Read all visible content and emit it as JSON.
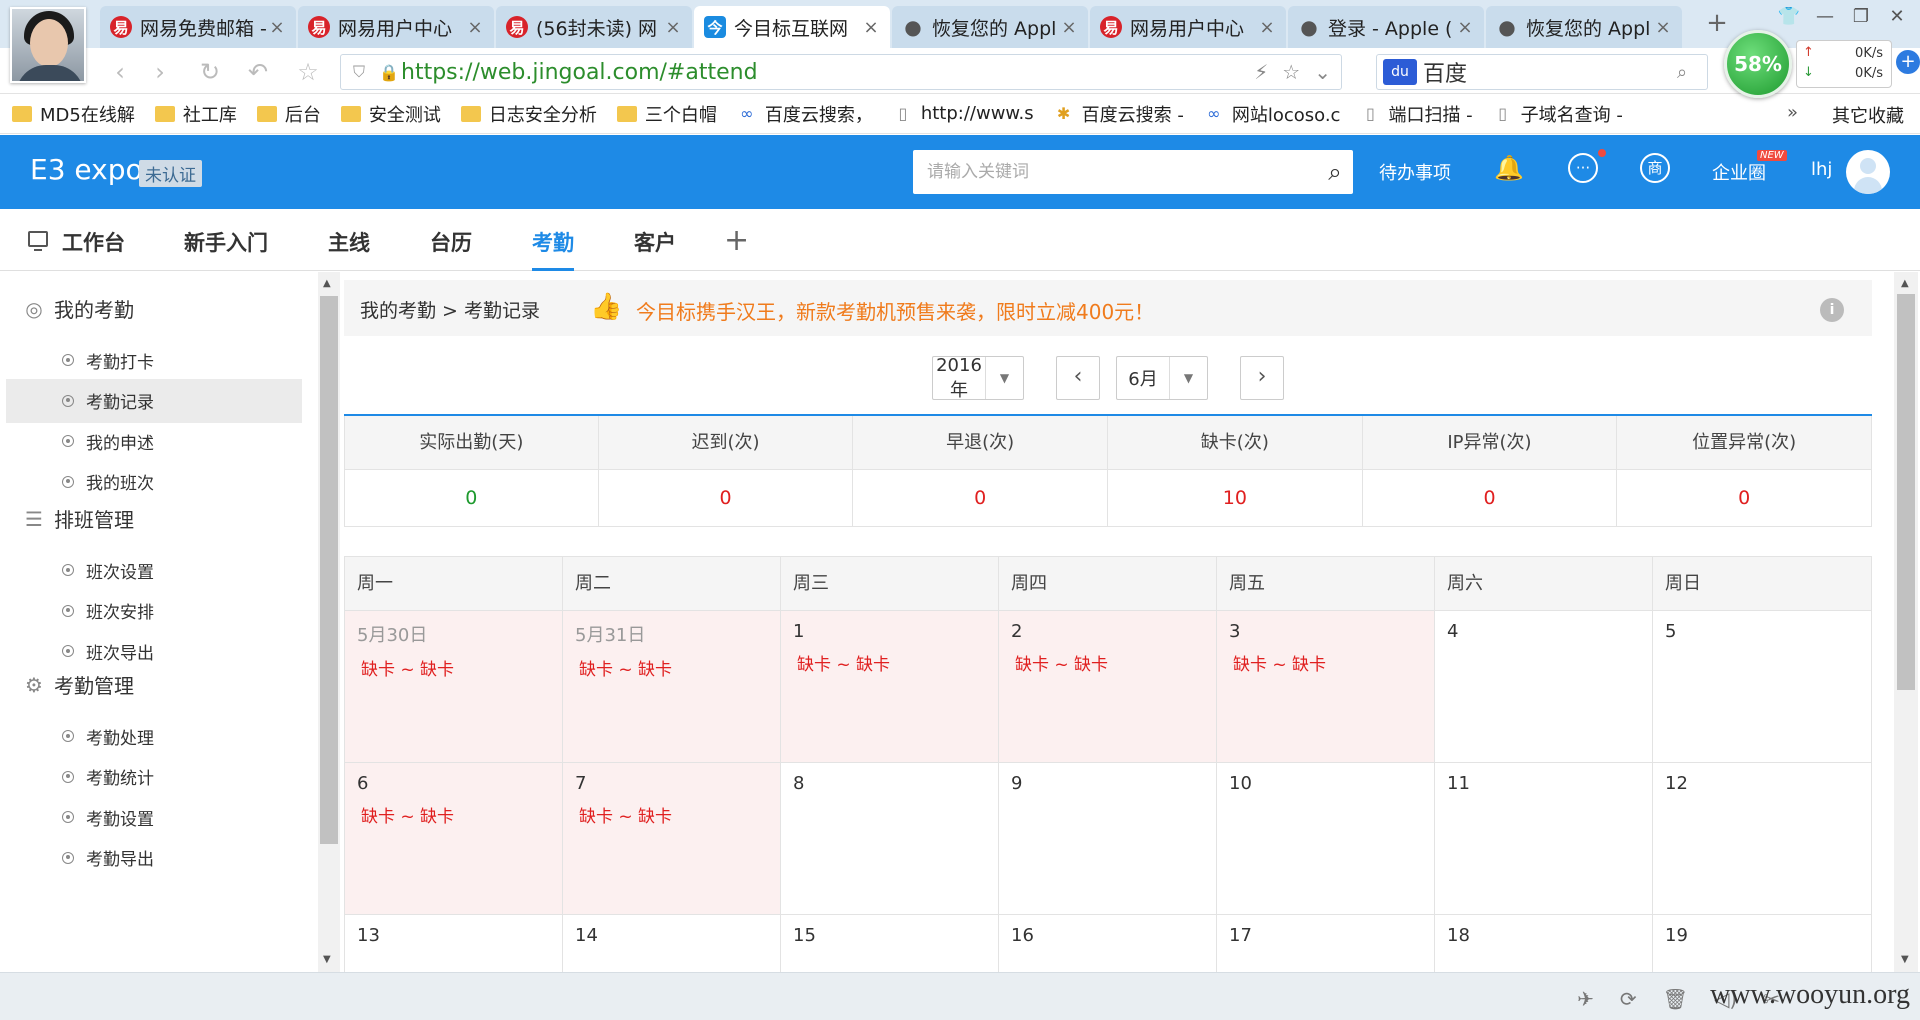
{
  "browser": {
    "tabs": [
      {
        "label": "网易免费邮箱 -",
        "icon": "netease-icon",
        "icon_char": "易"
      },
      {
        "label": "网易用户中心",
        "icon": "netease-icon",
        "icon_char": "易"
      },
      {
        "label": "(56封未读) 网",
        "icon": "netease-icon",
        "icon_char": "易"
      },
      {
        "label": "今目标互联网",
        "icon": "jingoal-icon",
        "icon_char": "今",
        "active": true
      },
      {
        "label": "恢复您的 Appl",
        "icon": "apple-icon",
        "icon_char": ""
      },
      {
        "label": "网易用户中心",
        "icon": "netease-icon",
        "icon_char": "易"
      },
      {
        "label": "登录 - Apple (",
        "icon": "apple-icon",
        "icon_char": ""
      },
      {
        "label": "恢复您的 Appl",
        "icon": "apple-icon",
        "icon_char": ""
      }
    ],
    "url": "https://web.jingoal.com/#attend",
    "search_engine": "百度",
    "speed": {
      "percent": "58%",
      "up": "0K/s",
      "down": "0K/s"
    },
    "bookmarks": [
      {
        "label": "MD5在线解",
        "icon": "folder-icon"
      },
      {
        "label": "社工库",
        "icon": "folder-icon"
      },
      {
        "label": "后台",
        "icon": "folder-icon"
      },
      {
        "label": "安全测试",
        "icon": "folder-icon"
      },
      {
        "label": "日志安全分析",
        "icon": "folder-icon"
      },
      {
        "label": "三个白帽",
        "icon": "folder-icon"
      },
      {
        "label": "百度云搜索，",
        "icon": "link-icon"
      },
      {
        "label": "http://www.s",
        "icon": "page-icon"
      },
      {
        "label": "百度云搜索 -",
        "icon": "puzzle-icon"
      },
      {
        "label": "网站locoso.c",
        "icon": "link-icon"
      },
      {
        "label": "端口扫描 -",
        "icon": "page-icon"
      },
      {
        "label": "子域名查询 -",
        "icon": "page-icon"
      }
    ],
    "bookmarks_more": "»",
    "bookmarks_other": "其它收藏"
  },
  "app": {
    "brand": "E3 expo",
    "brand_badge": "未认证",
    "search_placeholder": "请输入关键词",
    "todo": "待办事项",
    "business_icon_char": "商",
    "enterprise": "企业圈",
    "new_badge": "NEW",
    "username": "lhj",
    "accent_color": "#1e8ae6"
  },
  "module_tabs": [
    {
      "label": "工作台"
    },
    {
      "label": "新手入门"
    },
    {
      "label": "主线"
    },
    {
      "label": "台历"
    },
    {
      "label": "考勤",
      "active": true
    },
    {
      "label": "客户"
    }
  ],
  "sidebar": {
    "groups": [
      {
        "title": "我的考勤",
        "icon": "attendance-icon",
        "items": [
          "考勤打卡",
          "考勤记录",
          "我的申述",
          "我的班次"
        ]
      },
      {
        "title": "排班管理",
        "icon": "list-icon",
        "items": [
          "班次设置",
          "班次安排",
          "班次导出"
        ]
      },
      {
        "title": "考勤管理",
        "icon": "gear-icon",
        "items": [
          "考勤处理",
          "考勤统计",
          "考勤设置",
          "考勤导出"
        ]
      }
    ],
    "active_item": "考勤记录"
  },
  "main": {
    "breadcrumb": "我的考勤 > 考勤记录",
    "promo": "今目标携手汉王，新款考勤机预售来袭，限时立减400元！",
    "year": "2016年",
    "month": "6月",
    "stats": [
      {
        "label": "实际出勤(天)",
        "value": "0"
      },
      {
        "label": "迟到(次)",
        "value": "0"
      },
      {
        "label": "早退(次)",
        "value": "0"
      },
      {
        "label": "缺卡(次)",
        "value": "10"
      },
      {
        "label": "IP异常(次)",
        "value": "0"
      },
      {
        "label": "位置异常(次)",
        "value": "0"
      }
    ],
    "weekdays": [
      "周一",
      "周二",
      "周三",
      "周四",
      "周五",
      "周六",
      "周日"
    ],
    "weeks": [
      [
        {
          "day": "5月30日",
          "status": "缺卡 ~ 缺卡",
          "prev": true
        },
        {
          "day": "5月31日",
          "status": "缺卡 ~ 缺卡",
          "prev": true
        },
        {
          "day": "1",
          "status": "缺卡 ~ 缺卡"
        },
        {
          "day": "2",
          "status": "缺卡 ~ 缺卡"
        },
        {
          "day": "3",
          "status": "缺卡 ~ 缺卡"
        },
        {
          "day": "4",
          "status": ""
        },
        {
          "day": "5",
          "status": ""
        }
      ],
      [
        {
          "day": "6",
          "status": "缺卡 ~ 缺卡"
        },
        {
          "day": "7",
          "status": "缺卡 ~ 缺卡"
        },
        {
          "day": "8",
          "status": ""
        },
        {
          "day": "9",
          "status": ""
        },
        {
          "day": "10",
          "status": ""
        },
        {
          "day": "11",
          "status": ""
        },
        {
          "day": "12",
          "status": ""
        }
      ],
      [
        {
          "day": "13",
          "status": ""
        },
        {
          "day": "14",
          "status": ""
        },
        {
          "day": "15",
          "status": ""
        },
        {
          "day": "16",
          "status": ""
        },
        {
          "day": "17",
          "status": ""
        },
        {
          "day": "18",
          "status": ""
        },
        {
          "day": "19",
          "status": ""
        }
      ]
    ]
  },
  "watermark": "www.wooyun.org"
}
